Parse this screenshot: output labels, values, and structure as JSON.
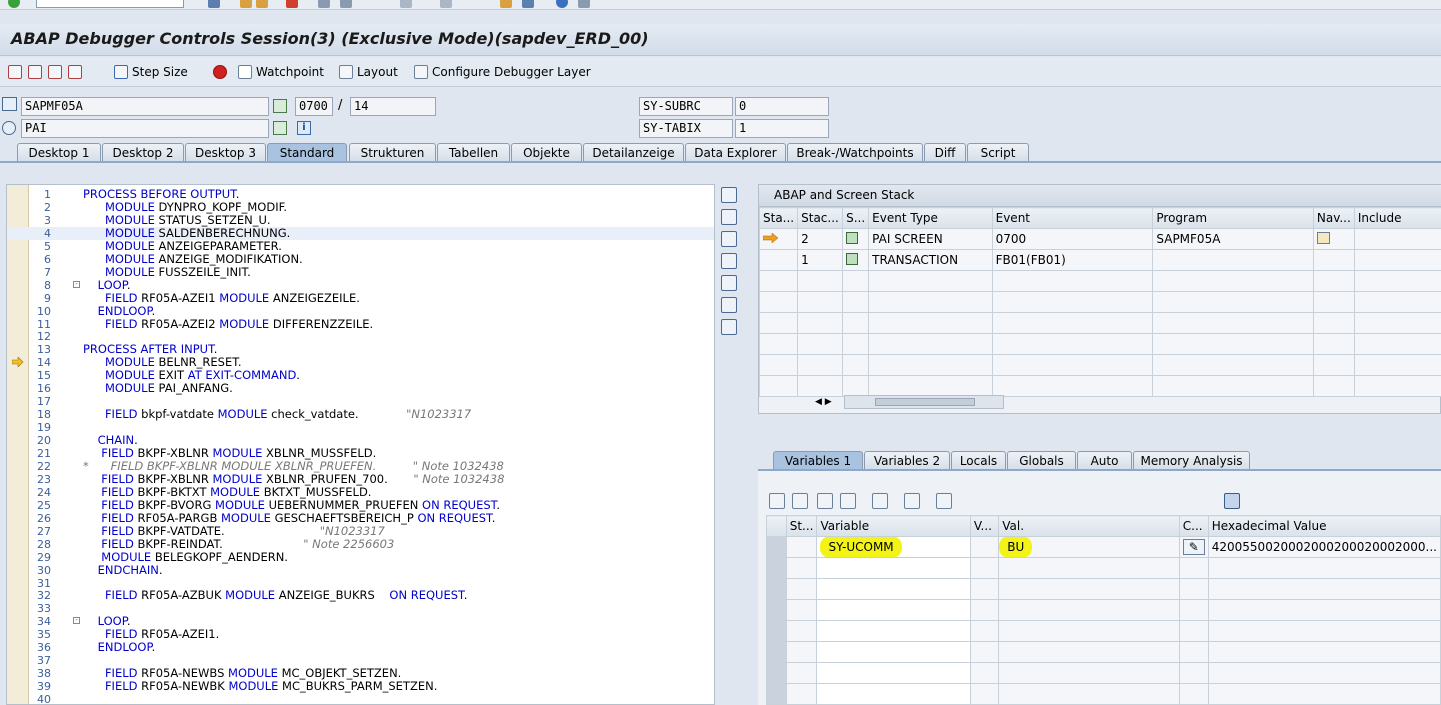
{
  "window": {
    "title": "ABAP Debugger Controls Session(3)  (Exclusive Mode)(sapdev_ERD_00)"
  },
  "toolbar": {
    "step_size_label": "Step Size",
    "watchpoint_label": "Watchpoint",
    "layout_label": "Layout",
    "configure_label": "Configure Debugger Layer"
  },
  "fields": {
    "program": "SAPMF05A",
    "screen": "0700",
    "separator": "/",
    "line": "14",
    "module": "PAI",
    "sy_subrc_label": "SY-SUBRC",
    "sy_subrc_value": "0",
    "sy_tabix_label": "SY-TABIX",
    "sy_tabix_value": "1"
  },
  "tabs": [
    {
      "label": "Desktop 1"
    },
    {
      "label": "Desktop 2"
    },
    {
      "label": "Desktop 3"
    },
    {
      "label": "Standard"
    },
    {
      "label": "Strukturen"
    },
    {
      "label": "Tabellen"
    },
    {
      "label": "Objekte"
    },
    {
      "label": "Detailanzeige"
    },
    {
      "label": "Data Explorer"
    },
    {
      "label": "Break-/Watchpoints"
    },
    {
      "label": "Diff"
    },
    {
      "label": "Script"
    }
  ],
  "active_tab": "Standard",
  "code": {
    "current_line": "14",
    "lines": [
      {
        "n": "1",
        "t": "PROCESS BEFORE OUTPUT."
      },
      {
        "n": "2",
        "t": "      MODULE DYNPRO_KOPF_MODIF."
      },
      {
        "n": "3",
        "t": "      MODULE STATUS_SETZEN_U."
      },
      {
        "n": "4",
        "t": "      MODULE SALDENBERECHNUNG."
      },
      {
        "n": "5",
        "t": "      MODULE ANZEIGEPARAMETER."
      },
      {
        "n": "6",
        "t": "      MODULE ANZEIGE_MODIFIKATION."
      },
      {
        "n": "7",
        "t": "      MODULE FUSSZEILE_INIT."
      },
      {
        "n": "8",
        "t": "    LOOP."
      },
      {
        "n": "9",
        "t": "      FIELD RF05A-AZEI1 MODULE ANZEIGEZEILE."
      },
      {
        "n": "10",
        "t": "    ENDLOOP."
      },
      {
        "n": "11",
        "t": "      FIELD RF05A-AZEI2 MODULE DIFFERENZZEILE."
      },
      {
        "n": "12",
        "t": ""
      },
      {
        "n": "13",
        "t": "PROCESS AFTER INPUT."
      },
      {
        "n": "14",
        "t": "      MODULE BELNR_RESET."
      },
      {
        "n": "15",
        "t": "      MODULE EXIT AT EXIT-COMMAND."
      },
      {
        "n": "16",
        "t": "      MODULE PAI_ANFANG."
      },
      {
        "n": "17",
        "t": ""
      },
      {
        "n": "18",
        "t": "      FIELD bkpf-vatdate MODULE check_vatdate.             \"N1023317"
      },
      {
        "n": "19",
        "t": ""
      },
      {
        "n": "20",
        "t": "    CHAIN."
      },
      {
        "n": "21",
        "t": "     FIELD BKPF-XBLNR MODULE XBLNR_MUSSFELD."
      },
      {
        "n": "22",
        "t": "*      FIELD BKPF-XBLNR MODULE XBLNR_PRUEFEN.          \" Note 1032438"
      },
      {
        "n": "23",
        "t": "     FIELD BKPF-XBLNR MODULE XBLNR_PRUFEN_700.       \" Note 1032438"
      },
      {
        "n": "24",
        "t": "     FIELD BKPF-BKTXT MODULE BKTXT_MUSSFELD."
      },
      {
        "n": "25",
        "t": "     FIELD BKPF-BVORG MODULE UEBERNUMMER_PRUEFEN ON REQUEST."
      },
      {
        "n": "26",
        "t": "     FIELD RF05A-PARGB MODULE GESCHAEFTSBEREICH_P ON REQUEST."
      },
      {
        "n": "27",
        "t": "     FIELD BKPF-VATDATE.                          \"N1023317"
      },
      {
        "n": "28",
        "t": "     FIELD BKPF-REINDAT.                      \" Note 2256603"
      },
      {
        "n": "29",
        "t": "     MODULE BELEGKOPF_AENDERN."
      },
      {
        "n": "30",
        "t": "    ENDCHAIN."
      },
      {
        "n": "31",
        "t": ""
      },
      {
        "n": "32",
        "t": "      FIELD RF05A-AZBUK MODULE ANZEIGE_BUKRS    ON REQUEST."
      },
      {
        "n": "33",
        "t": ""
      },
      {
        "n": "34",
        "t": "    LOOP."
      },
      {
        "n": "35",
        "t": "      FIELD RF05A-AZEI1."
      },
      {
        "n": "36",
        "t": "    ENDLOOP."
      },
      {
        "n": "37",
        "t": ""
      },
      {
        "n": "38",
        "t": "      FIELD RF05A-NEWBS MODULE MC_OBJEKT_SETZEN."
      },
      {
        "n": "39",
        "t": "      FIELD RF05A-NEWBK MODULE MC_BUKRS_PARM_SETZEN."
      },
      {
        "n": "40",
        "t": ""
      }
    ]
  },
  "stack": {
    "title": "ABAP and Screen Stack",
    "columns": [
      "Sta...",
      "Stac...",
      "S...",
      "Event Type",
      "Event",
      "Program",
      "Nav...",
      "Include"
    ],
    "rows": [
      {
        "level": "2",
        "event_type": "PAI SCREEN",
        "event": "0700",
        "program": "SAPMF05A"
      },
      {
        "level": "1",
        "event_type": "TRANSACTION",
        "event": "FB01(FB01)",
        "program": ""
      }
    ]
  },
  "var_tabs": [
    {
      "label": "Variables 1"
    },
    {
      "label": "Variables 2"
    },
    {
      "label": "Locals"
    },
    {
      "label": "Globals"
    },
    {
      "label": "Auto"
    },
    {
      "label": "Memory Analysis"
    }
  ],
  "variables": {
    "columns": [
      "St...",
      "Variable",
      "V...",
      "Val.",
      "C...",
      "Hexadecimal Value"
    ],
    "rows": [
      {
        "variable": "SY-UCOMM",
        "value": "BU",
        "hex": "4200550020002000200020002000..."
      }
    ]
  },
  "colors": {
    "keyword": "#0000cc",
    "highlight": "#f3f318",
    "active_tab": "#a8c2e0"
  }
}
